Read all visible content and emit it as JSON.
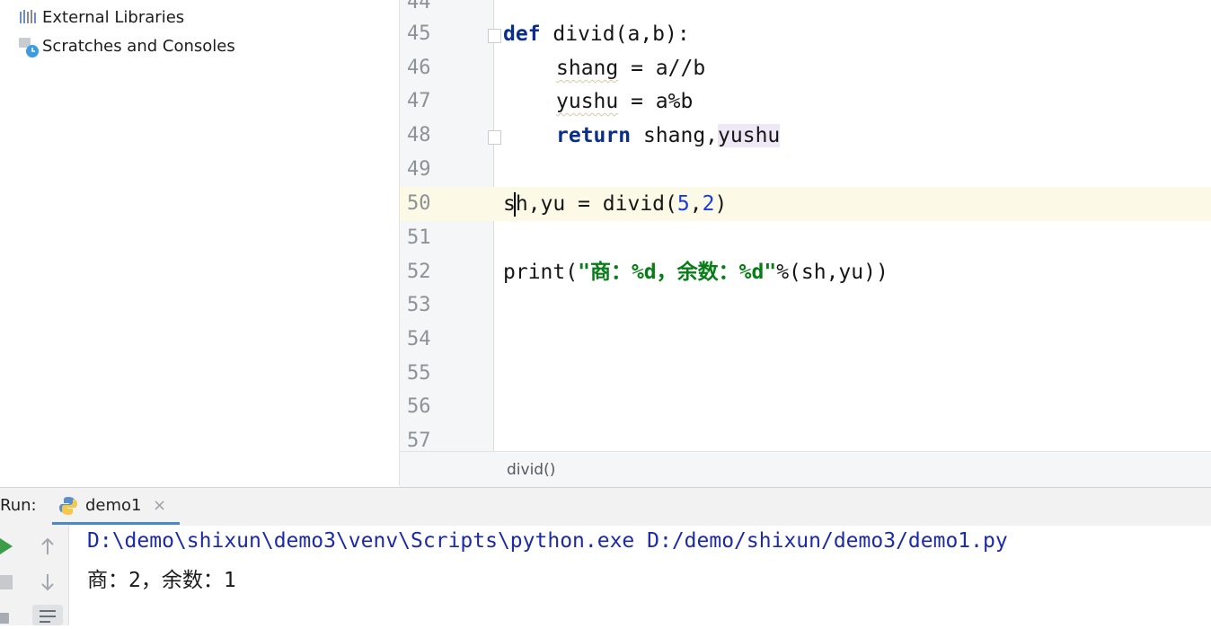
{
  "project_tree": {
    "items": [
      {
        "label": "External Libraries",
        "icon": "library-icon"
      },
      {
        "label": "Scratches and Consoles",
        "icon": "scratches-icon"
      }
    ]
  },
  "editor": {
    "line_numbers": [
      "44",
      "45",
      "46",
      "47",
      "48",
      "49",
      "50",
      "51",
      "52",
      "53",
      "54",
      "55",
      "56",
      "57"
    ],
    "code": {
      "l45_kw": "def",
      "l45_rest": " divid(a,b):",
      "l46_var": "shang",
      "l46_rest": " = a//b",
      "l47_var": "yushu",
      "l47_rest": " = a%b",
      "l48_kw": "return",
      "l48_a": " shang,",
      "l48_b": "yushu",
      "l50_a": "sh,yu = divid(",
      "l50_n1": "5",
      "l50_c": ",",
      "l50_n2": "2",
      "l50_e": ")",
      "l52_a": "print(",
      "l52_str": "\"商：%d，余数：%d\"",
      "l52_b": "%(sh,yu))"
    },
    "current_line": "50",
    "breadcrumb": "divid()"
  },
  "run_panel": {
    "label": "Run:",
    "tab_name": "demo1",
    "tab_close": "×",
    "console": {
      "command": "D:\\demo\\shixun\\demo3\\venv\\Scripts\\python.exe D:/demo/shixun/demo3/demo1.py",
      "output": "商：2，余数：1"
    }
  },
  "colors": {
    "keyword": "#0b2e8c",
    "number": "#1939e6",
    "string": "#067d17",
    "console_path": "#1d2aa8",
    "run_green": "#3c9c4a"
  }
}
